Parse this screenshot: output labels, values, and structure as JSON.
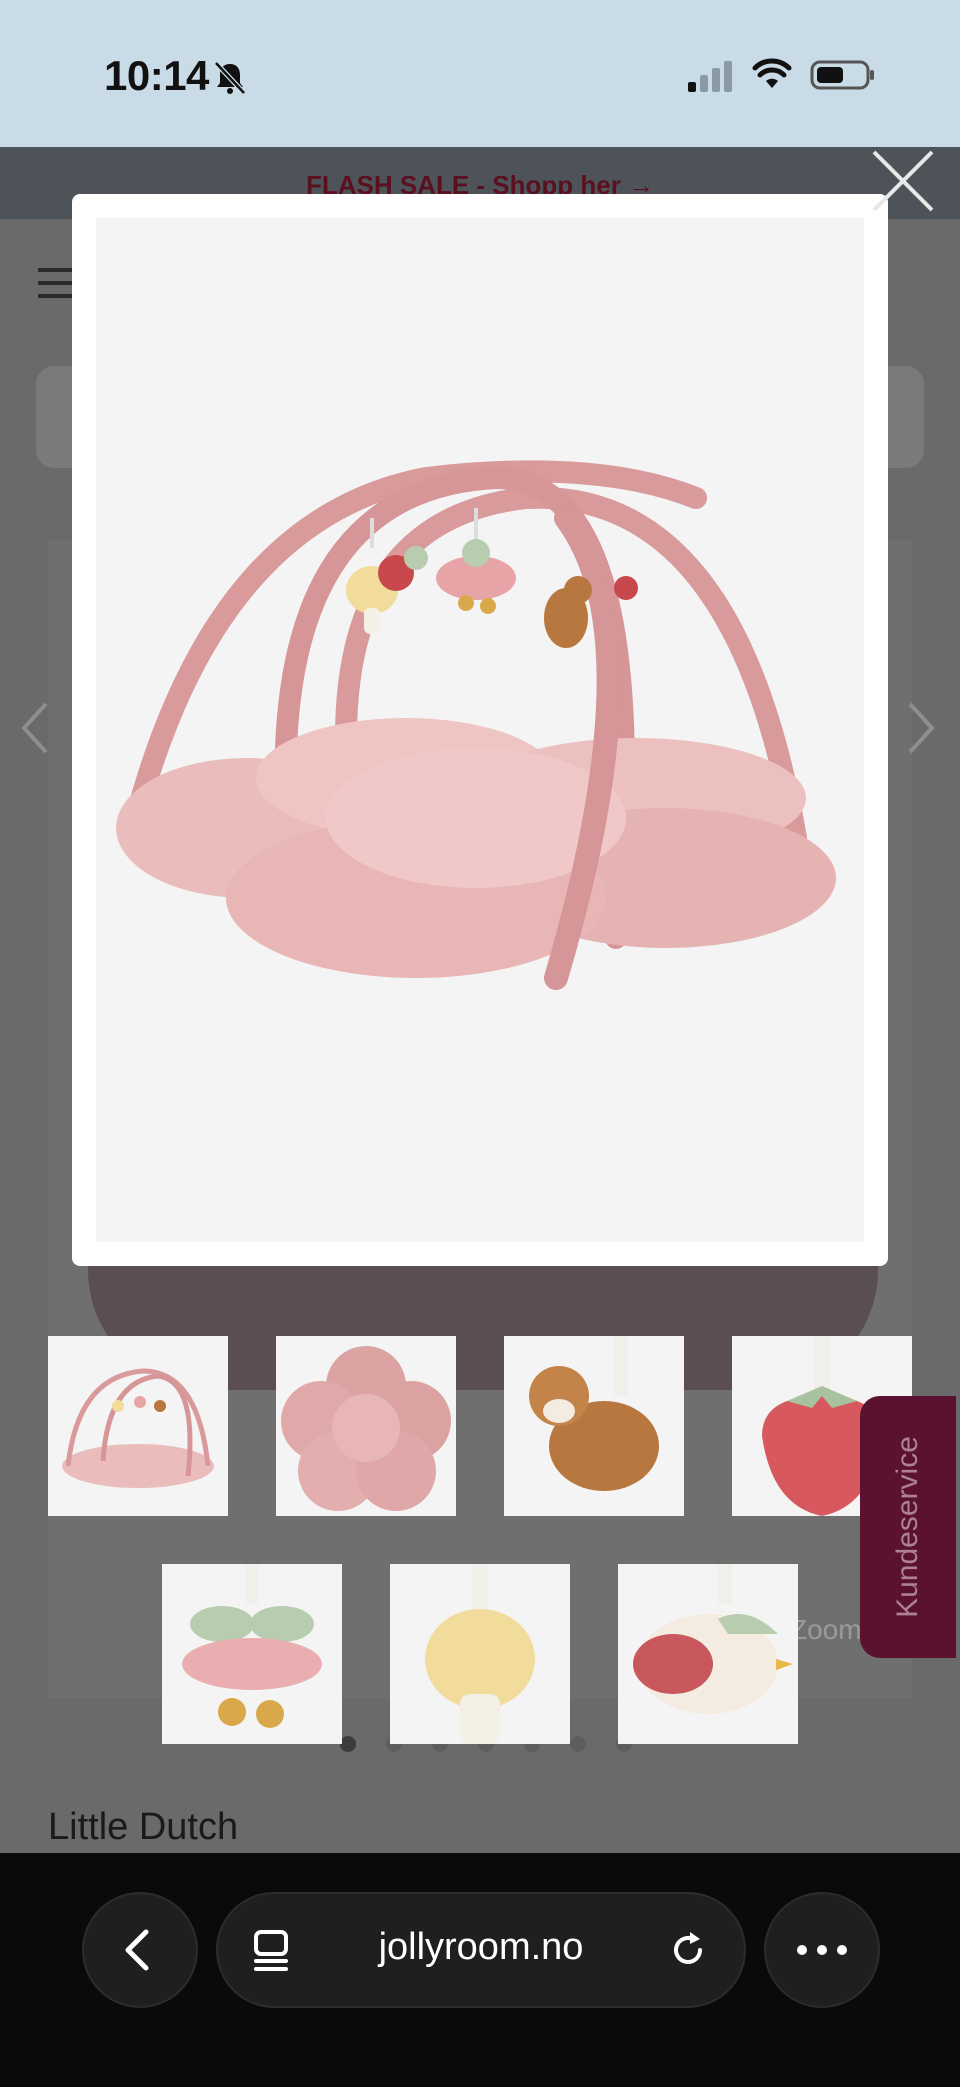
{
  "status_bar": {
    "time": "10:14"
  },
  "page": {
    "flash_banner": "FLASH SALE - Shopp her →",
    "zoom_label": "Zoom",
    "brand": "Little Dutch",
    "customer_service": "Kundeservice"
  },
  "modal": {
    "main_image": "play-gym-flower-pink",
    "thumbnails_row1": [
      "play-gym",
      "flower-mat",
      "deer-toy",
      "strawberry-toy"
    ],
    "thumbnails_row2": [
      "flower-toy",
      "mushroom-toy",
      "bird-toy"
    ]
  },
  "browser": {
    "url": "jollyroom.no"
  },
  "colors": {
    "mat_pink": "#e9b6b6",
    "arch_pink": "#d99a9c",
    "modal_bg": "#ffffff",
    "overlay": "#6a6a6a"
  }
}
